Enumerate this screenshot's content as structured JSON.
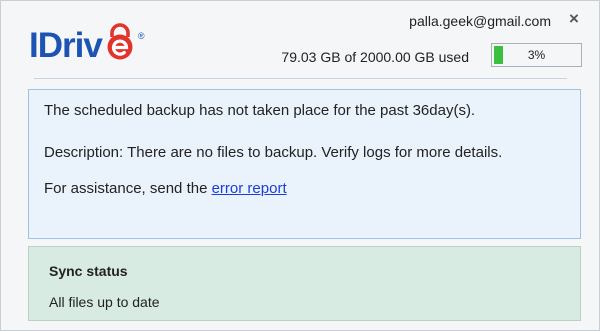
{
  "brand": {
    "logo_text": "IDriv",
    "logo_e": "e",
    "registered_mark": "®",
    "primary_color": "#1c54b4",
    "accent_color": "#e2342b"
  },
  "header": {
    "email": "palla.geek@gmail.com",
    "close_icon": "×",
    "usage_text": "79.03 GB of 2000.00 GB used",
    "usage_percent_label": "3%",
    "usage_percent": 3,
    "usage_color": "#3bbf3f"
  },
  "alert": {
    "line1": "The scheduled backup has not taken place for the past 36day(s).",
    "line2": "Description: There are no files to backup. Verify logs for more details.",
    "line3_prefix": "For assistance, send the ",
    "line3_link": "error report"
  },
  "sync": {
    "title": "Sync status",
    "status": "All files up to date"
  }
}
